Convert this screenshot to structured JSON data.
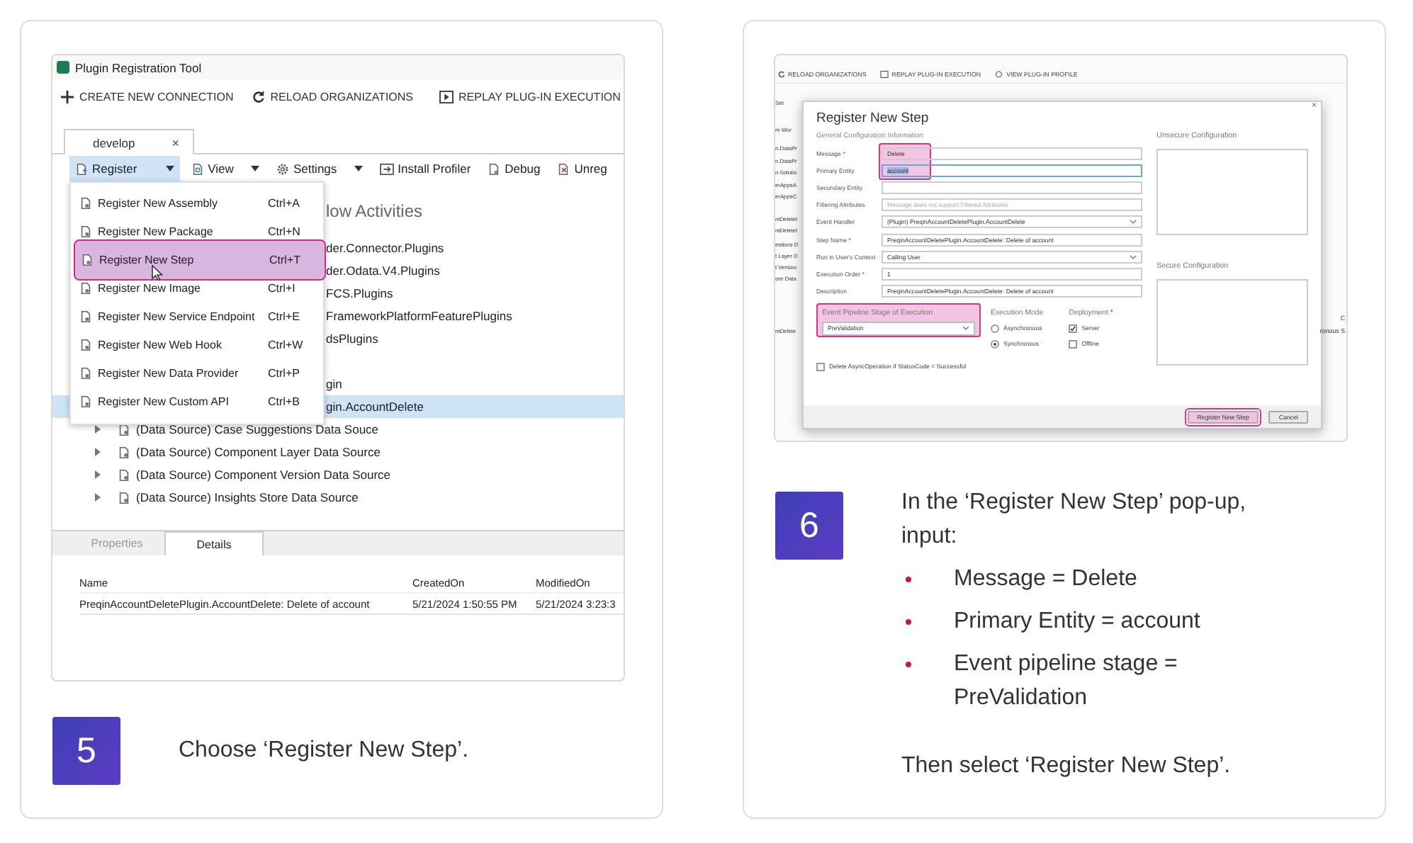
{
  "steps": [
    {
      "kind": "single",
      "number": "5",
      "text": "Choose ‘Register New Step’.",
      "screenshot": {
        "title": "Plugin Registration Tool",
        "toolbar": [
          "CREATE NEW CONNECTION",
          "RELOAD ORGANIZATIONS",
          "REPLAY PLUG-IN EXECUTION"
        ],
        "connection_tab": {
          "label": "develop",
          "close": "×"
        },
        "commands": [
          {
            "kind": "dropdown",
            "label": "Register",
            "expanded": true
          },
          {
            "kind": "dropdown",
            "label": "View",
            "expanded": false
          },
          {
            "kind": "dropdown",
            "label": "Settings",
            "expanded": false
          },
          {
            "kind": "button",
            "label": "Install Profiler"
          },
          {
            "kind": "button",
            "label": "Debug"
          },
          {
            "kind": "button",
            "label": "Unreg"
          }
        ],
        "menu": [
          {
            "label": "Register New Assembly",
            "shortcut": "Ctrl+A",
            "selected": false
          },
          {
            "label": "Register New Package",
            "shortcut": "Ctrl+N",
            "selected": false
          },
          {
            "label": "Register New Step",
            "shortcut": "Ctrl+T",
            "selected": true
          },
          {
            "label": "Register New Image",
            "shortcut": "Ctrl+I",
            "selected": false
          },
          {
            "label": "Register New Service Endpoint",
            "shortcut": "Ctrl+E",
            "selected": false
          },
          {
            "label": "Register New Web Hook",
            "shortcut": "Ctrl+W",
            "selected": false
          },
          {
            "label": "Register New Data Provider",
            "shortcut": "Ctrl+P",
            "selected": false
          },
          {
            "label": "Register New Custom API",
            "shortcut": "Ctrl+B",
            "selected": false
          }
        ],
        "tree_heading": "low Activities",
        "tree_rows": [
          {
            "kind": "partial",
            "label": "der.Connector.Plugins",
            "selected": false
          },
          {
            "kind": "partial",
            "label": "der.Odata.V4.Plugins",
            "selected": false
          },
          {
            "kind": "partial",
            "label": "FCS.Plugins",
            "selected": false
          },
          {
            "kind": "partial",
            "label": "FrameworkPlatformFeaturePlugins",
            "selected": false
          },
          {
            "kind": "partial",
            "label": "dsPlugins",
            "selected": false
          },
          {
            "kind": "partial",
            "label": "gin",
            "selected": false
          },
          {
            "kind": "partial",
            "label": "gin.AccountDelete",
            "selected": true
          },
          {
            "kind": "node",
            "label": "(Data Source) Case Suggestions Data Souce",
            "selected": false
          },
          {
            "kind": "node",
            "label": "(Data Source) Component Layer Data Source",
            "selected": false
          },
          {
            "kind": "node",
            "label": "(Data Source) Component Version Data Source",
            "selected": false
          },
          {
            "kind": "node",
            "label": "(Data Source) Insights Store Data Source",
            "selected": false
          }
        ],
        "bottom_tabs": [
          {
            "label": "Properties",
            "selected": false
          },
          {
            "label": "Details",
            "selected": true
          }
        ],
        "details": {
          "columns": [
            "Name",
            "CreatedOn",
            "ModifiedOn"
          ],
          "rows": [
            [
              "PreqinAccountDeletePlugin.AccountDelete: Delete of account",
              "5/21/2024 1:50:55 PM",
              "5/21/2024 3:23:3"
            ]
          ]
        }
      }
    },
    {
      "kind": "list",
      "number": "6",
      "intro": "In the ‘Register New Step’ pop-up, input:",
      "bullets": [
        "Message = Delete",
        "Primary Entity = account",
        "Event pipeline stage = PreValidation"
      ],
      "outro": "Then select ‘Register New Step’.",
      "screenshot": {
        "toolbar": [
          "RELOAD ORGANIZATIONS",
          "REPLAY PLUG-IN EXECUTION",
          "VIEW PLUG-IN PROFILE"
        ],
        "left_fragments": [
          "Set",
          "m Wor",
          "n.DataPr",
          "n.DataPr",
          "n.Solutio",
          "erAppsA",
          "erAppsC",
          "ntDeleteI",
          "ntDeleteI",
          "estions D",
          "t Layer D",
          "t Version",
          "ore Data",
          "ntDelete"
        ],
        "right_fragments": [
          "C",
          "ronous S"
        ],
        "dialog": {
          "title": "Register New Step",
          "close": "×",
          "section": "General Configuration Information",
          "fields": [
            {
              "kind": "text",
              "label": "Message",
              "mark": "*",
              "value": "Delete",
              "highlighted": true,
              "text_selected": false
            },
            {
              "kind": "text",
              "label": "Primary Entity",
              "value": "account",
              "highlighted": true,
              "text_selected": true
            },
            {
              "kind": "text",
              "label": "Secondary Entity",
              "highlighted": false,
              "text_selected": false
            },
            {
              "kind": "text",
              "label": "Filtering Attributes",
              "placeholder": "Message does not support Filtered Attributes",
              "highlighted": false,
              "text_selected": false
            },
            {
              "kind": "select",
              "label": "Event Handler",
              "value": "(Plugin) PreqinAccountDeletePlugin.AccountDelete",
              "highlighted": false,
              "text_selected": false
            },
            {
              "kind": "text",
              "label": "Step Name",
              "mark": "*",
              "value": "PreqinAccountDeletePlugin.AccountDelete: Delete of account",
              "highlighted": false,
              "text_selected": false
            },
            {
              "kind": "select",
              "label": "Run in User's Context",
              "value": "Calling User",
              "highlighted": false,
              "text_selected": false
            },
            {
              "kind": "text",
              "label": "Execution Order",
              "mark": "*",
              "value": "1",
              "highlighted": false,
              "text_selected": false
            },
            {
              "kind": "text",
              "label": "Description",
              "value": "PreqinAccountDeletePlugin.AccountDelete: Delete of account",
              "highlighted": false,
              "text_selected": false
            }
          ],
          "pipeline": {
            "label": "Event Pipeline Stage of Execution",
            "value": "PreValidation",
            "highlighted": true
          },
          "execution_mode": {
            "label": "Execution Mode",
            "options": [
              {
                "label": "Asynchronous",
                "selected": false
              },
              {
                "label": "Synchronous",
                "selected": true
              }
            ]
          },
          "deployment": {
            "label": "Deployment",
            "mark": "*",
            "options": [
              {
                "label": "Server",
                "checked": true
              },
              {
                "label": "Offline",
                "checked": false
              }
            ]
          },
          "delete_async": {
            "label": "Delete AsyncOperation if StatusCode = Successful",
            "checked": false
          },
          "unsecure_label": "Unsecure Configuration",
          "secure_label": "Secure Configuration",
          "buttons": [
            {
              "label": "Register New Step",
              "highlighted": true
            },
            {
              "label": "Cancel",
              "highlighted": false
            }
          ]
        }
      }
    }
  ]
}
